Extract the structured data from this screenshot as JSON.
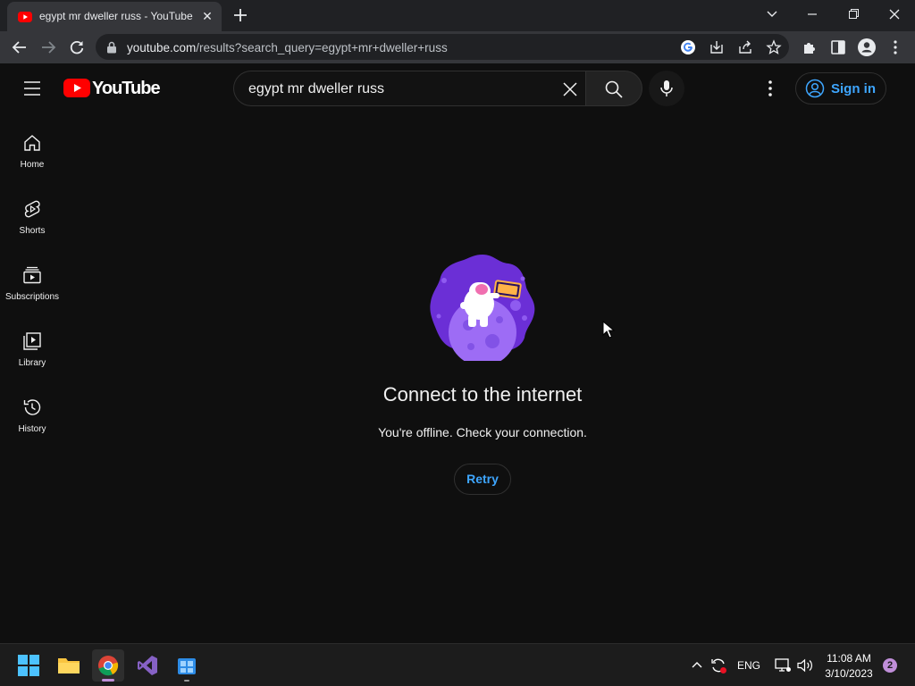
{
  "browser": {
    "tab_title": "egypt mr dweller russ - YouTube",
    "tab_close": "✕",
    "url_host": "youtube.com",
    "url_path": "/results?search_query=egypt+mr+dweller+russ"
  },
  "header": {
    "logo_text": "YouTube",
    "search_value": "egypt mr dweller russ",
    "signin_label": "Sign in"
  },
  "sidebar": {
    "items": [
      {
        "label": "Home",
        "icon": "home-icon"
      },
      {
        "label": "Shorts",
        "icon": "shorts-icon"
      },
      {
        "label": "Subscriptions",
        "icon": "subscriptions-icon"
      },
      {
        "label": "Library",
        "icon": "library-icon"
      },
      {
        "label": "History",
        "icon": "history-icon"
      }
    ]
  },
  "main": {
    "title": "Connect to the internet",
    "message": "You're offline. Check your connection.",
    "retry_label": "Retry"
  },
  "taskbar": {
    "language": "ENG",
    "time": "11:08 AM",
    "date": "3/10/2023",
    "notification_count": "2"
  },
  "colors": {
    "yt_red": "#ff0000",
    "link_blue": "#3ea6ff",
    "background": "#0f0f0f"
  }
}
